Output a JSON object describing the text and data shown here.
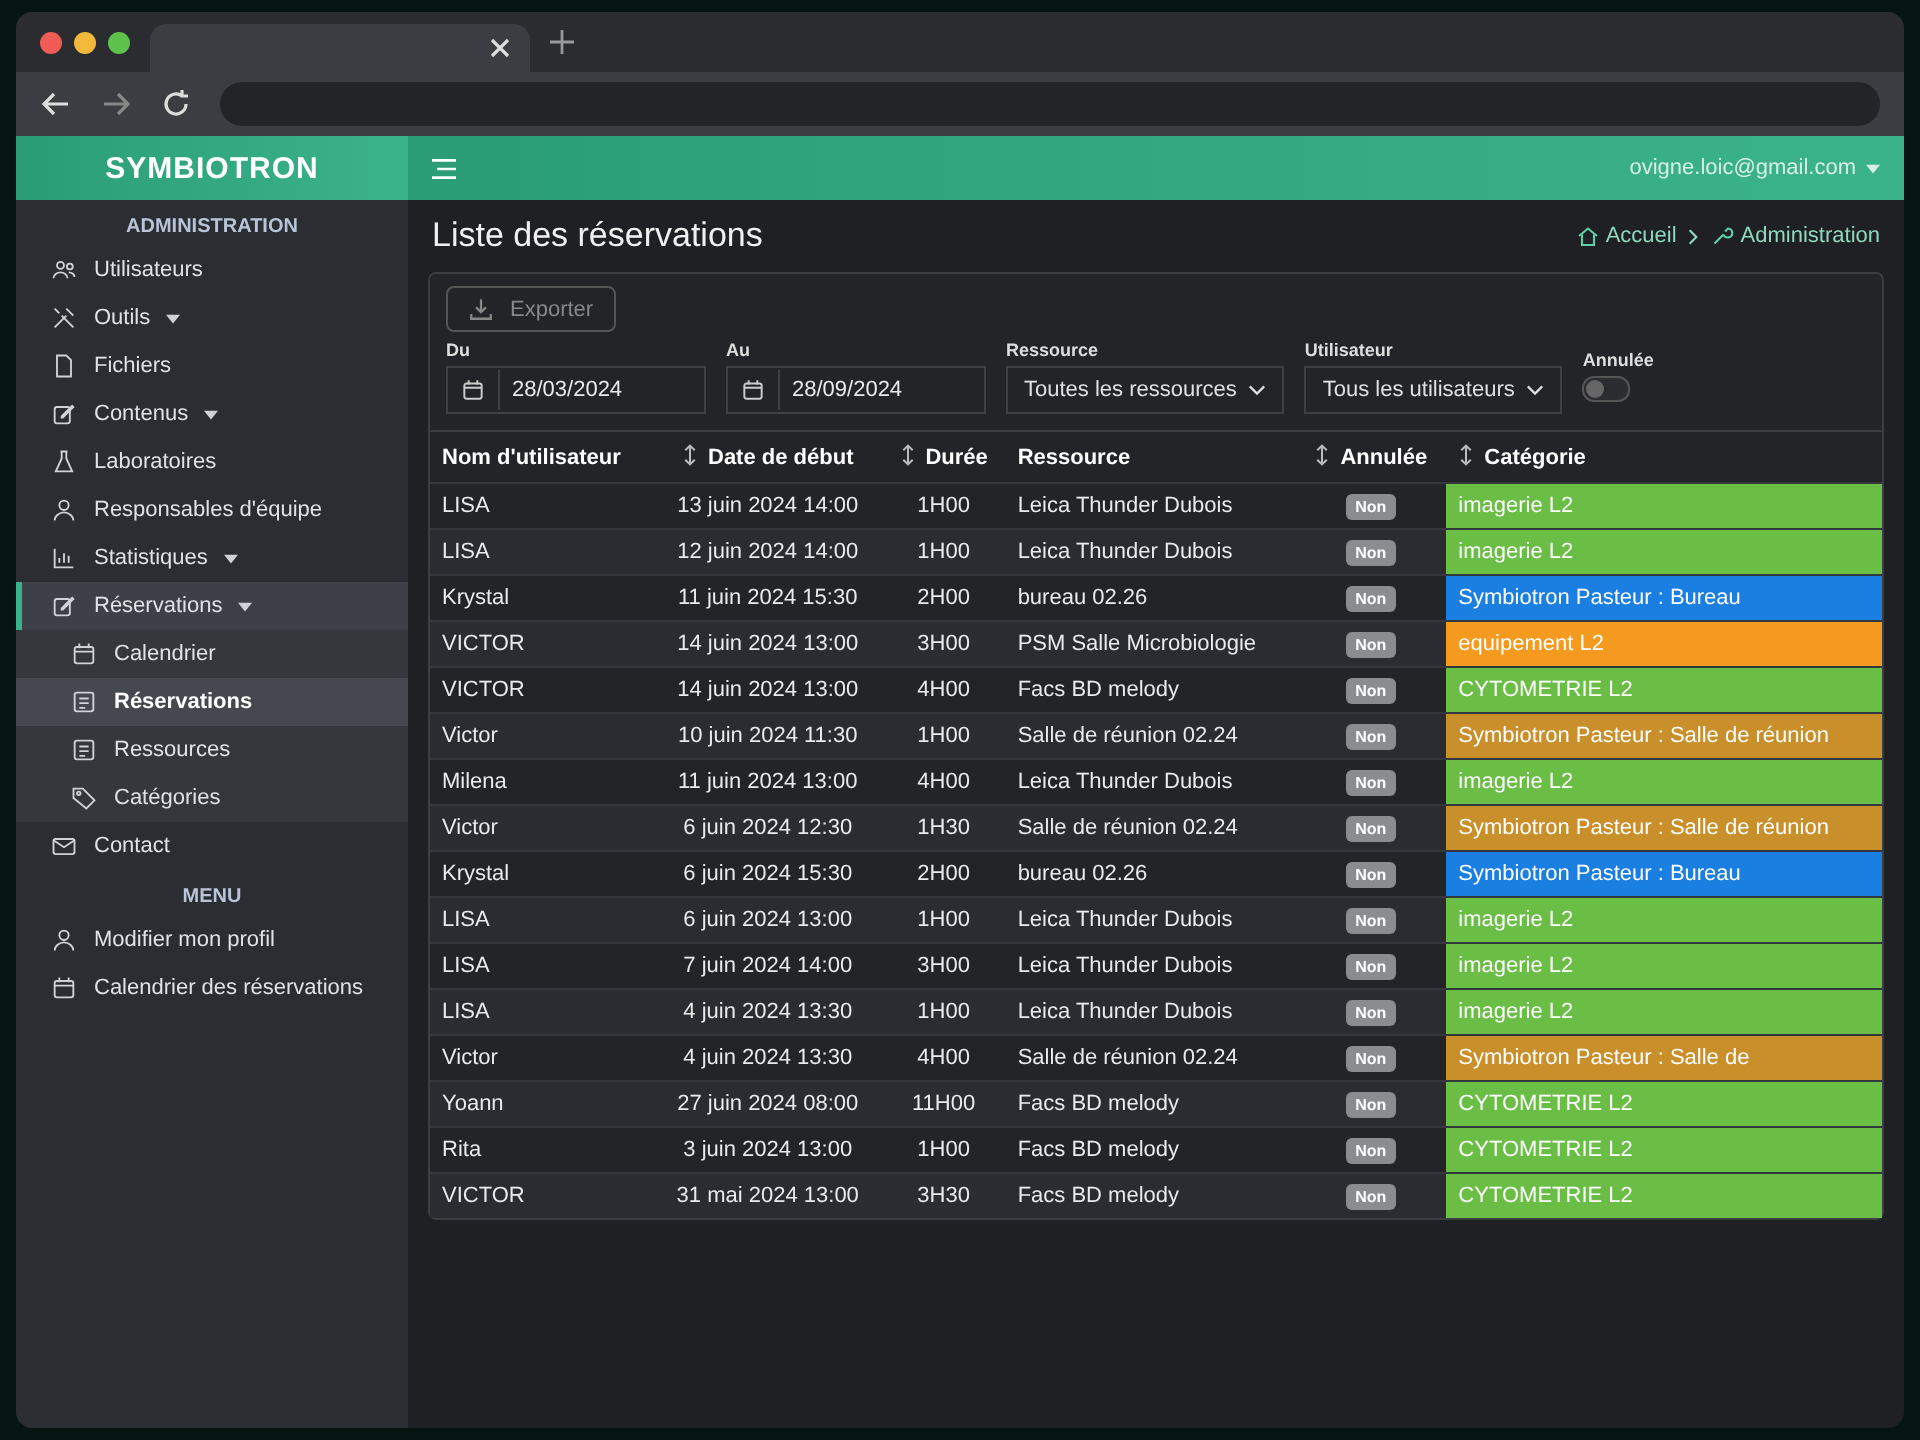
{
  "header": {
    "user_email": "ovigne.loic@gmail.com"
  },
  "breadcrumb": [
    "Accueil",
    "Administration"
  ],
  "sidebar": {
    "logo": "SYMBIOTRON",
    "sections": [
      {
        "title": "ADMINISTRATION",
        "items": [
          {
            "label": "Utilisateurs",
            "dropdown": false,
            "expanded": false,
            "selected": false
          },
          {
            "label": "Outils",
            "dropdown": true,
            "expanded": false,
            "selected": false
          },
          {
            "label": "Fichiers",
            "dropdown": false,
            "expanded": false,
            "selected": false
          },
          {
            "label": "Contenus",
            "dropdown": true,
            "expanded": false,
            "selected": false
          },
          {
            "label": "Laboratoires",
            "dropdown": false,
            "expanded": false,
            "selected": false
          },
          {
            "label": "Responsables d'équipe",
            "dropdown": false,
            "expanded": false,
            "selected": false
          },
          {
            "label": "Statistiques",
            "dropdown": true,
            "expanded": false,
            "selected": false
          },
          {
            "label": "Réservations",
            "dropdown": true,
            "expanded": true,
            "selected": false,
            "children": [
              {
                "label": "Calendrier",
                "selected": false
              },
              {
                "label": "Réservations",
                "selected": true
              },
              {
                "label": "Ressources",
                "selected": false
              },
              {
                "label": "Catégories",
                "selected": false
              }
            ]
          },
          {
            "label": "Contact",
            "dropdown": false,
            "expanded": false,
            "selected": false
          }
        ]
      },
      {
        "title": "MENU",
        "items": [
          {
            "label": "Modifier mon profil",
            "dropdown": false,
            "expanded": false,
            "selected": false
          },
          {
            "label": "Calendrier des réservations",
            "dropdown": false,
            "expanded": false,
            "selected": false
          }
        ]
      }
    ]
  },
  "page": {
    "title": "Liste des réservations"
  },
  "filters": {
    "export_label": "Exporter",
    "from": {
      "label": "Du",
      "value": "28/03/2024"
    },
    "to": {
      "label": "Au",
      "value": "28/09/2024"
    },
    "resource": {
      "label": "Ressource",
      "value": "Toutes les ressources"
    },
    "user": {
      "label": "Utilisateur",
      "value": "Tous les utilisateurs"
    },
    "cancelled": {
      "label": "Annulée",
      "on": false
    }
  },
  "table": {
    "columns": [
      {
        "label": "Nom d'utilisateur",
        "sortable": false
      },
      {
        "label": "Date de début",
        "sortable": true
      },
      {
        "label": "Durée",
        "sortable": true
      },
      {
        "label": "Ressource",
        "sortable": false
      },
      {
        "label": "Annulée",
        "sortable": true
      },
      {
        "label": "Catégorie",
        "sortable": true
      }
    ],
    "rows": [
      {
        "user": "LISA",
        "start": "13 juin 2024 14:00",
        "duration": "1H00",
        "resource": "Leica Thunder Dubois",
        "cancelled": "Non",
        "category": "imagerie L2",
        "color": "#6abd45"
      },
      {
        "user": "LISA",
        "start": "12 juin 2024 14:00",
        "duration": "1H00",
        "resource": "Leica Thunder Dubois",
        "cancelled": "Non",
        "category": "imagerie L2",
        "color": "#6abd45"
      },
      {
        "user": "Krystal",
        "start": "11 juin 2024 15:30",
        "duration": "2H00",
        "resource": "bureau 02.26",
        "cancelled": "Non",
        "category": "Symbiotron Pasteur : Bureau",
        "color": "#1a7fe0"
      },
      {
        "user": "VICTOR",
        "start": "14 juin 2024 13:00",
        "duration": "3H00",
        "resource": "PSM Salle Microbiologie",
        "cancelled": "Non",
        "category": "equipement L2",
        "color": "#f39a1f"
      },
      {
        "user": "VICTOR",
        "start": "14 juin 2024 13:00",
        "duration": "4H00",
        "resource": "Facs BD melody",
        "cancelled": "Non",
        "category": "CYTOMETRIE L2",
        "color": "#6abd45"
      },
      {
        "user": "Victor",
        "start": "10 juin 2024 11:30",
        "duration": "1H00",
        "resource": "Salle de réunion 02.24",
        "cancelled": "Non",
        "category": "Symbiotron Pasteur : Salle de réunion",
        "color": "#c98f2a"
      },
      {
        "user": "Milena",
        "start": "11 juin 2024 13:00",
        "duration": "4H00",
        "resource": "Leica Thunder Dubois",
        "cancelled": "Non",
        "category": "imagerie L2",
        "color": "#6abd45"
      },
      {
        "user": "Victor",
        "start": "6 juin 2024 12:30",
        "duration": "1H30",
        "resource": "Salle de réunion 02.24",
        "cancelled": "Non",
        "category": "Symbiotron Pasteur : Salle de réunion",
        "color": "#c98f2a"
      },
      {
        "user": "Krystal",
        "start": "6 juin 2024 15:30",
        "duration": "2H00",
        "resource": "bureau 02.26",
        "cancelled": "Non",
        "category": "Symbiotron Pasteur : Bureau",
        "color": "#1a7fe0"
      },
      {
        "user": "LISA",
        "start": "6 juin 2024 13:00",
        "duration": "1H00",
        "resource": "Leica Thunder Dubois",
        "cancelled": "Non",
        "category": "imagerie L2",
        "color": "#6abd45"
      },
      {
        "user": "LISA",
        "start": "7 juin 2024 14:00",
        "duration": "3H00",
        "resource": "Leica Thunder Dubois",
        "cancelled": "Non",
        "category": "imagerie L2",
        "color": "#6abd45"
      },
      {
        "user": "LISA",
        "start": "4 juin 2024 13:30",
        "duration": "1H00",
        "resource": "Leica Thunder Dubois",
        "cancelled": "Non",
        "category": "imagerie L2",
        "color": "#6abd45"
      },
      {
        "user": "Victor",
        "start": "4 juin 2024 13:30",
        "duration": "4H00",
        "resource": "Salle de réunion 02.24",
        "cancelled": "Non",
        "category": "Symbiotron Pasteur : Salle de",
        "color": "#c98f2a"
      },
      {
        "user": "Yoann",
        "start": "27 juin 2024 08:00",
        "duration": "11H00",
        "resource": "Facs BD melody",
        "cancelled": "Non",
        "category": "CYTOMETRIE L2",
        "color": "#6abd45"
      },
      {
        "user": "Rita",
        "start": "3 juin 2024 13:00",
        "duration": "1H00",
        "resource": "Facs BD melody",
        "cancelled": "Non",
        "category": "CYTOMETRIE L2",
        "color": "#6abd45"
      },
      {
        "user": "VICTOR",
        "start": "31 mai 2024 13:00",
        "duration": "3H30",
        "resource": "Facs BD melody",
        "cancelled": "Non",
        "category": "CYTOMETRIE L2",
        "color": "#6abd45"
      }
    ]
  }
}
